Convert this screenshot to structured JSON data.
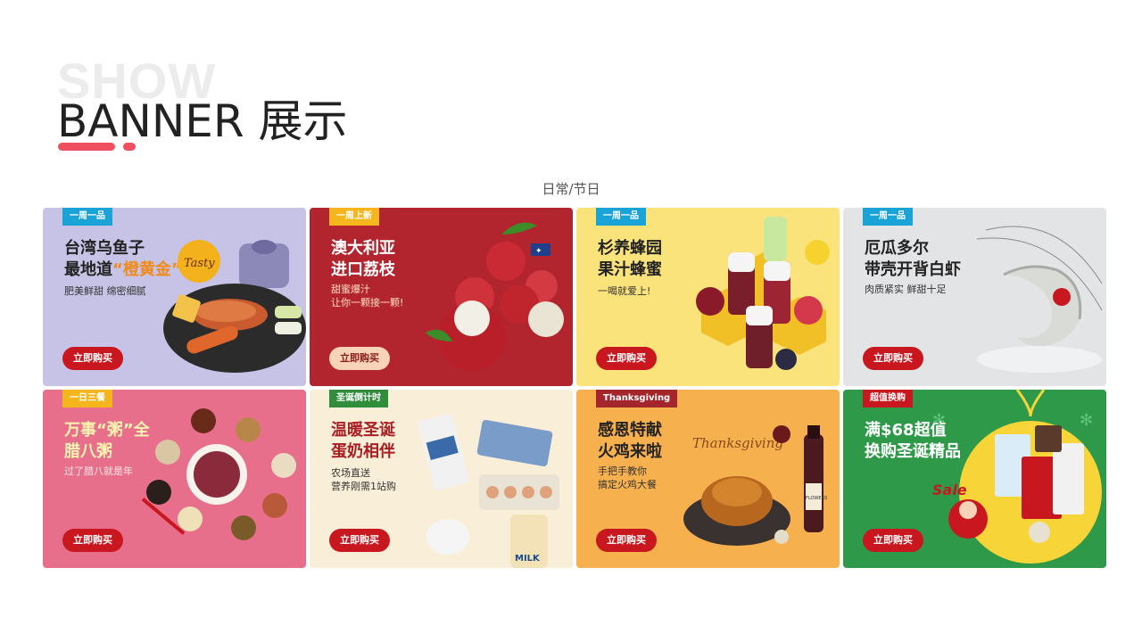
{
  "header": {
    "ghost_text": "SHOW",
    "title": "BANNER 展示",
    "subtitle": "日常/节日"
  },
  "buy_label": "立即购买",
  "cards": [
    {
      "tag": "一周一品",
      "tag_color": "#1aa3d6",
      "headline_1": "台湾乌鱼子",
      "headline_2a": "最地道",
      "headline_2b": "“橙黄金”",
      "desc_1": "肥美鲜甜 绵密细腻"
    },
    {
      "tag": "一周上新",
      "tag_color": "#f5b51c",
      "headline_1": "澳大利亚",
      "headline_2": "进口荔枝",
      "desc_1": "甜蜜爆汁",
      "desc_2": "让你一颗接一颗!"
    },
    {
      "tag": "一周一品",
      "tag_color": "#1aa3d6",
      "headline_1": "杉养蜂园",
      "headline_2": "果汁蜂蜜",
      "desc_1": "一喝就爱上!"
    },
    {
      "tag": "一周一品",
      "tag_color": "#1aa3d6",
      "headline_1": "厄瓜多尔",
      "headline_2": "带壳开背白虾",
      "desc_1": "肉质紧实 鲜甜十足"
    },
    {
      "tag": "一日三餐",
      "tag_color": "#f5b51c",
      "headline_1": "万事“粥”全",
      "headline_2": "腊八粥",
      "desc_1": "过了腊八就是年"
    },
    {
      "tag": "圣诞倒计时",
      "tag_color": "#2f8d3c",
      "headline_1": "温暖圣诞",
      "headline_2": "蛋奶相伴",
      "desc_1": "农场直送",
      "desc_2": "营养刚需1站购"
    },
    {
      "tag": "Thanksgiving",
      "tag_color": "#a4262c",
      "headline_1": "感恩特献",
      "headline_2": "火鸡来啦",
      "desc_1": "手把手教你",
      "desc_2": "搞定火鸡大餐"
    },
    {
      "tag": "超值换购",
      "tag_color": "#c8171e",
      "headline_1": "满$68超值",
      "headline_2": "换购圣诞精品",
      "desc_1": ""
    }
  ],
  "colors": {
    "accent": "#ef4f5f",
    "buy_button": "#c8171e"
  },
  "decor_text": {
    "tasty": "Tasty",
    "thanksgiving": "Thanksgiving",
    "flowers": "FLOWERS",
    "milk": "MILK",
    "sale": "Sale"
  }
}
